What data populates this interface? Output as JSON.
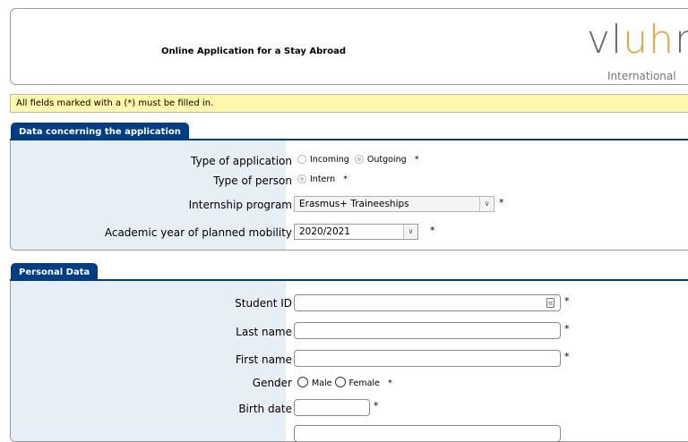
{
  "header": {
    "title": "Online Application for a Stay Abroad",
    "logo_main": "vluhr",
    "logo_sub": "International"
  },
  "notice": "All fields marked with a (*) must be filled in.",
  "sections": {
    "application": {
      "tab": "Data concerning the application",
      "type_of_application": {
        "label": "Type of application",
        "options": [
          "Incoming",
          "Outgoing"
        ],
        "selected": "Outgoing",
        "required": "*"
      },
      "type_of_person": {
        "label": "Type of person",
        "options": [
          "Intern"
        ],
        "selected": "Intern",
        "required": "*"
      },
      "internship_program": {
        "label": "Internship program",
        "value": "Erasmus+ Traineeships",
        "required": "*"
      },
      "academic_year": {
        "label": "Academic year of planned mobility",
        "value": "2020/2021",
        "required": "*"
      }
    },
    "personal": {
      "tab": "Personal Data",
      "student_id": {
        "label": "Student ID",
        "value": "",
        "required": "*"
      },
      "last_name": {
        "label": "Last name",
        "value": "",
        "required": "*"
      },
      "first_name": {
        "label": "First name",
        "value": "",
        "required": "*"
      },
      "gender": {
        "label": "Gender",
        "options": [
          "Male",
          "Female"
        ],
        "required": "*"
      },
      "birth_date": {
        "label": "Birth date",
        "value": "",
        "required": "*"
      }
    }
  },
  "icons": {
    "select_arrow": "chevron-down-icon",
    "id_card": "id-card-icon"
  },
  "colors": {
    "tab_blue": "#003d87",
    "label_bg": "#e8eef6",
    "notice_bg": "#fff8a8",
    "logo_gray": "#6b6b6b",
    "logo_accent": "#e8a33a"
  }
}
